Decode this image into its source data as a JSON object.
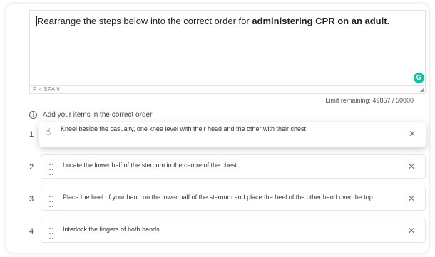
{
  "editor": {
    "prompt_prefix": "Rearrange the steps below into the correct order for ",
    "prompt_bold": "administering CPR on an adult.",
    "grammarly_letter": "G",
    "path": "P » SPAN",
    "limit": "Limit remaining:  49857 / 50000"
  },
  "instruction": {
    "icon": "i",
    "text": "Add your items in the correct order"
  },
  "items": [
    {
      "number": "1",
      "text": "Kneel beside the casualty, one knee level with their head and the other with their chest"
    },
    {
      "number": "2",
      "text": "Locate the lower half of the sternum in the centre of the chest"
    },
    {
      "number": "3",
      "text": "Place the heel of your hand on the lower half of the sternum and place the heel of the other hand over the top"
    },
    {
      "number": "4",
      "text": "Interlock the fingers of both hands"
    }
  ],
  "close_glyph": "✕",
  "colors": {
    "grammarly": "#15c39a"
  }
}
